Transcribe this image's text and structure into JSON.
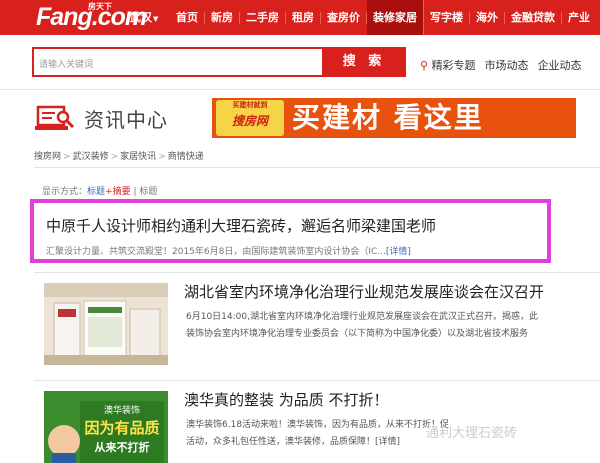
{
  "header": {
    "logo_text": "Fang.com",
    "logo_tag": "房天下",
    "city": "武汉",
    "nav": [
      "首页",
      "新房",
      "二手房",
      "租房",
      "查房价",
      "装修家居",
      "写字楼",
      "海外",
      "金融贷款",
      "产业"
    ],
    "active_nav_index": 5
  },
  "search": {
    "placeholder": "请输入关键词",
    "button_label": "搜 索",
    "quick_links": [
      "精彩专题",
      "市场动态",
      "企业动态"
    ]
  },
  "section": {
    "title": "资讯中心",
    "banner_stamp_small": "买建材就到",
    "banner_stamp_big": "搜房网",
    "banner_slogan": "买建材 看这里"
  },
  "breadcrumb": [
    "搜房网",
    "武汉装修",
    "家居快讯",
    "商情快递"
  ],
  "display_mode": {
    "label": "显示方式：",
    "option1_a": "标题",
    "option1_b": "+摘要",
    "divider": " | ",
    "option2": "标题"
  },
  "featured": {
    "title": "中原千人设计师相约通利大理石瓷砖，邂逅名师梁建国老师",
    "summary": "汇聚设计力量、共筑交流殿堂！2015年6月8日，由国际建筑装饰室内设计协会（IC...",
    "more": "[详情]"
  },
  "articles": [
    {
      "title": "湖北省室内环境净化治理行业规范发展座谈会在汉召开",
      "summary_lines": [
        "6月10日14:00,湖北省室内环境净化治理行业规范发展座谈会在武汉正式召开。揭惑，此",
        "装饰协会室内环境净化治理专业委员会（以下简称为中国净化委）以及湖北省技术服务"
      ]
    },
    {
      "title": "澳华真的整装 为品质 不打折！",
      "summary_lines": [
        "澳华装饰6.18活动来啦！澳华装饰，因为有品质，从来不打折！促",
        "活动，众多礼包任性送，澳华装修，品质保障！[详情]"
      ],
      "thumb_text_top": "澳华装饰",
      "thumb_text_mid": "因为有品质",
      "thumb_text_bot": "从来不打折"
    }
  ],
  "watermark": "通利大理石瓷砖",
  "colors": {
    "brand_red": "#d8201c",
    "highlight_magenta": "#e040d8",
    "link_blue": "#3d6ab5"
  }
}
